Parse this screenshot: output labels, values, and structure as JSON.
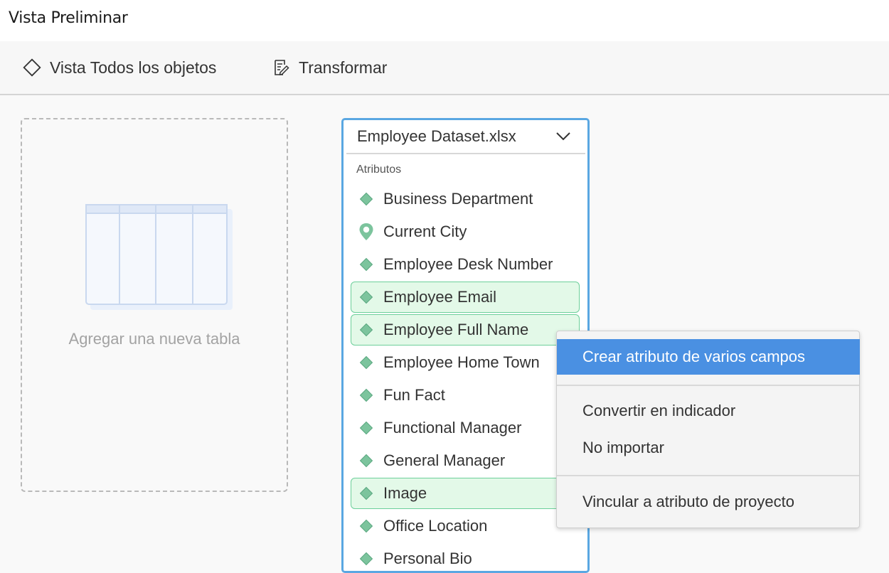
{
  "window": {
    "title": "Vista Preliminar"
  },
  "toolbar": {
    "view_all_label": "Vista Todos los objetos",
    "view_all_icon": "diamond-outline-icon",
    "transform_label": "Transformar",
    "transform_icon": "edit-document-icon"
  },
  "drop_zone": {
    "label": "Agregar una nueva tabla"
  },
  "table_card": {
    "file_name": "Employee Dataset.xlsx",
    "section_label": "Atributos",
    "attributes": [
      {
        "name": "Business Department",
        "icon": "attribute-diamond-icon",
        "selected": false
      },
      {
        "name": "Current City",
        "icon": "location-pin-icon",
        "selected": false
      },
      {
        "name": "Employee Desk Number",
        "icon": "attribute-diamond-icon",
        "selected": false
      },
      {
        "name": "Employee Email",
        "icon": "attribute-diamond-icon",
        "selected": true
      },
      {
        "name": "Employee Full Name",
        "icon": "attribute-diamond-icon",
        "selected": true
      },
      {
        "name": "Employee Home Town",
        "icon": "attribute-diamond-icon",
        "selected": false
      },
      {
        "name": "Fun Fact",
        "icon": "attribute-diamond-icon",
        "selected": false
      },
      {
        "name": "Functional Manager",
        "icon": "attribute-diamond-icon",
        "selected": false
      },
      {
        "name": "General Manager",
        "icon": "attribute-diamond-icon",
        "selected": false
      },
      {
        "name": "Image",
        "icon": "attribute-diamond-icon",
        "selected": true
      },
      {
        "name": "Office Location",
        "icon": "attribute-diamond-icon",
        "selected": false
      },
      {
        "name": "Personal Bio",
        "icon": "attribute-diamond-icon",
        "selected": false
      }
    ]
  },
  "context_menu": {
    "items": [
      {
        "label": "Crear atributo de varios campos",
        "highlighted": true
      },
      {
        "label": "Convertir en indicador",
        "highlighted": false
      },
      {
        "label": "No importar",
        "highlighted": false
      },
      {
        "label": "Vincular a atributo de proyecto",
        "highlighted": false
      }
    ]
  },
  "colors": {
    "accent_blue": "#4a90e2",
    "card_border": "#5aa7e2",
    "attribute_green": "#7cc49d",
    "selection_fill": "#e3f9e8",
    "selection_border": "#6ccf9a"
  }
}
